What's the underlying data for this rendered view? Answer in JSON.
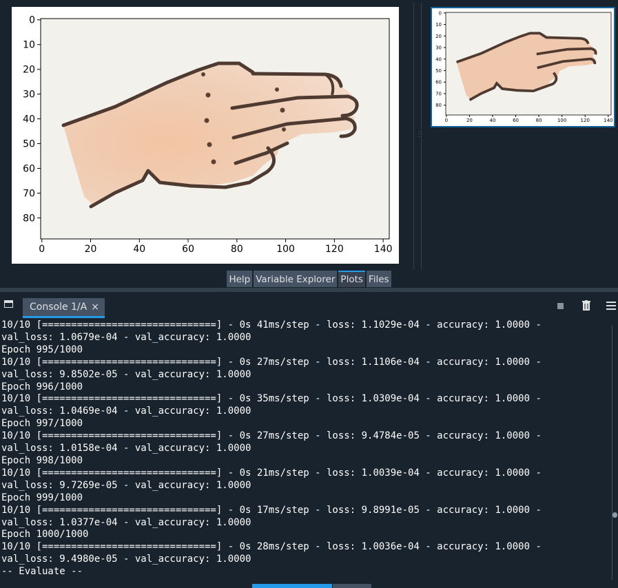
{
  "plots": {
    "main_figure": {
      "image_label": "hand-gesture-image",
      "x_ticks": [
        "0",
        "20",
        "40",
        "60",
        "80",
        "100",
        "120",
        "140"
      ],
      "y_ticks": [
        "0",
        "10",
        "20",
        "30",
        "40",
        "50",
        "60",
        "70",
        "80"
      ]
    },
    "thumbnail": {
      "x_ticks": [
        "0",
        "20",
        "40",
        "60",
        "80",
        "100",
        "120",
        "140"
      ],
      "y_ticks": [
        "0",
        "10",
        "20",
        "30",
        "40",
        "50",
        "60",
        "70",
        "80"
      ]
    },
    "tabs": [
      {
        "label": "Help",
        "active": false
      },
      {
        "label": "Variable Explorer",
        "active": false
      },
      {
        "label": "Plots",
        "active": true
      },
      {
        "label": "Files",
        "active": false
      }
    ]
  },
  "console": {
    "tab_label": "Console 1/A",
    "close_glyph": "×",
    "lines": [
      "10/10 [==============================] - 0s 41ms/step - loss: 1.1029e-04 - accuracy: 1.0000 -",
      "val_loss: 1.0679e-04 - val_accuracy: 1.0000",
      "Epoch 995/1000",
      "10/10 [==============================] - 0s 27ms/step - loss: 1.1106e-04 - accuracy: 1.0000 -",
      "val_loss: 9.8502e-05 - val_accuracy: 1.0000",
      "Epoch 996/1000",
      "10/10 [==============================] - 0s 35ms/step - loss: 1.0309e-04 - accuracy: 1.0000 -",
      "val_loss: 1.0469e-04 - val_accuracy: 1.0000",
      "Epoch 997/1000",
      "10/10 [==============================] - 0s 27ms/step - loss: 9.4784e-05 - accuracy: 1.0000 -",
      "val_loss: 1.0158e-04 - val_accuracy: 1.0000",
      "Epoch 998/1000",
      "10/10 [==============================] - 0s 21ms/step - loss: 1.0039e-04 - accuracy: 1.0000 -",
      "val_loss: 9.7269e-05 - val_accuracy: 1.0000",
      "Epoch 999/1000",
      "10/10 [==============================] - 0s 17ms/step - loss: 9.8991e-05 - accuracy: 1.0000 -",
      "val_loss: 1.0377e-04 - val_accuracy: 1.0000",
      "Epoch 1000/1000",
      "10/10 [==============================] - 0s 28ms/step - loss: 1.0036e-04 - accuracy: 1.0000 -",
      "val_loss: 9.4980e-05 - val_accuracy: 1.0000",
      "-- Evaluate --"
    ]
  },
  "icons": {
    "new_console": "window-icon",
    "stop": "stop-icon",
    "trash": "trash-icon",
    "menu": "hamburger-menu-icon"
  },
  "colors": {
    "background": "#19232d",
    "tab_background": "#455364",
    "accent": "#259ae9",
    "skin": "#efc8ad",
    "outline": "#4e3a30"
  }
}
